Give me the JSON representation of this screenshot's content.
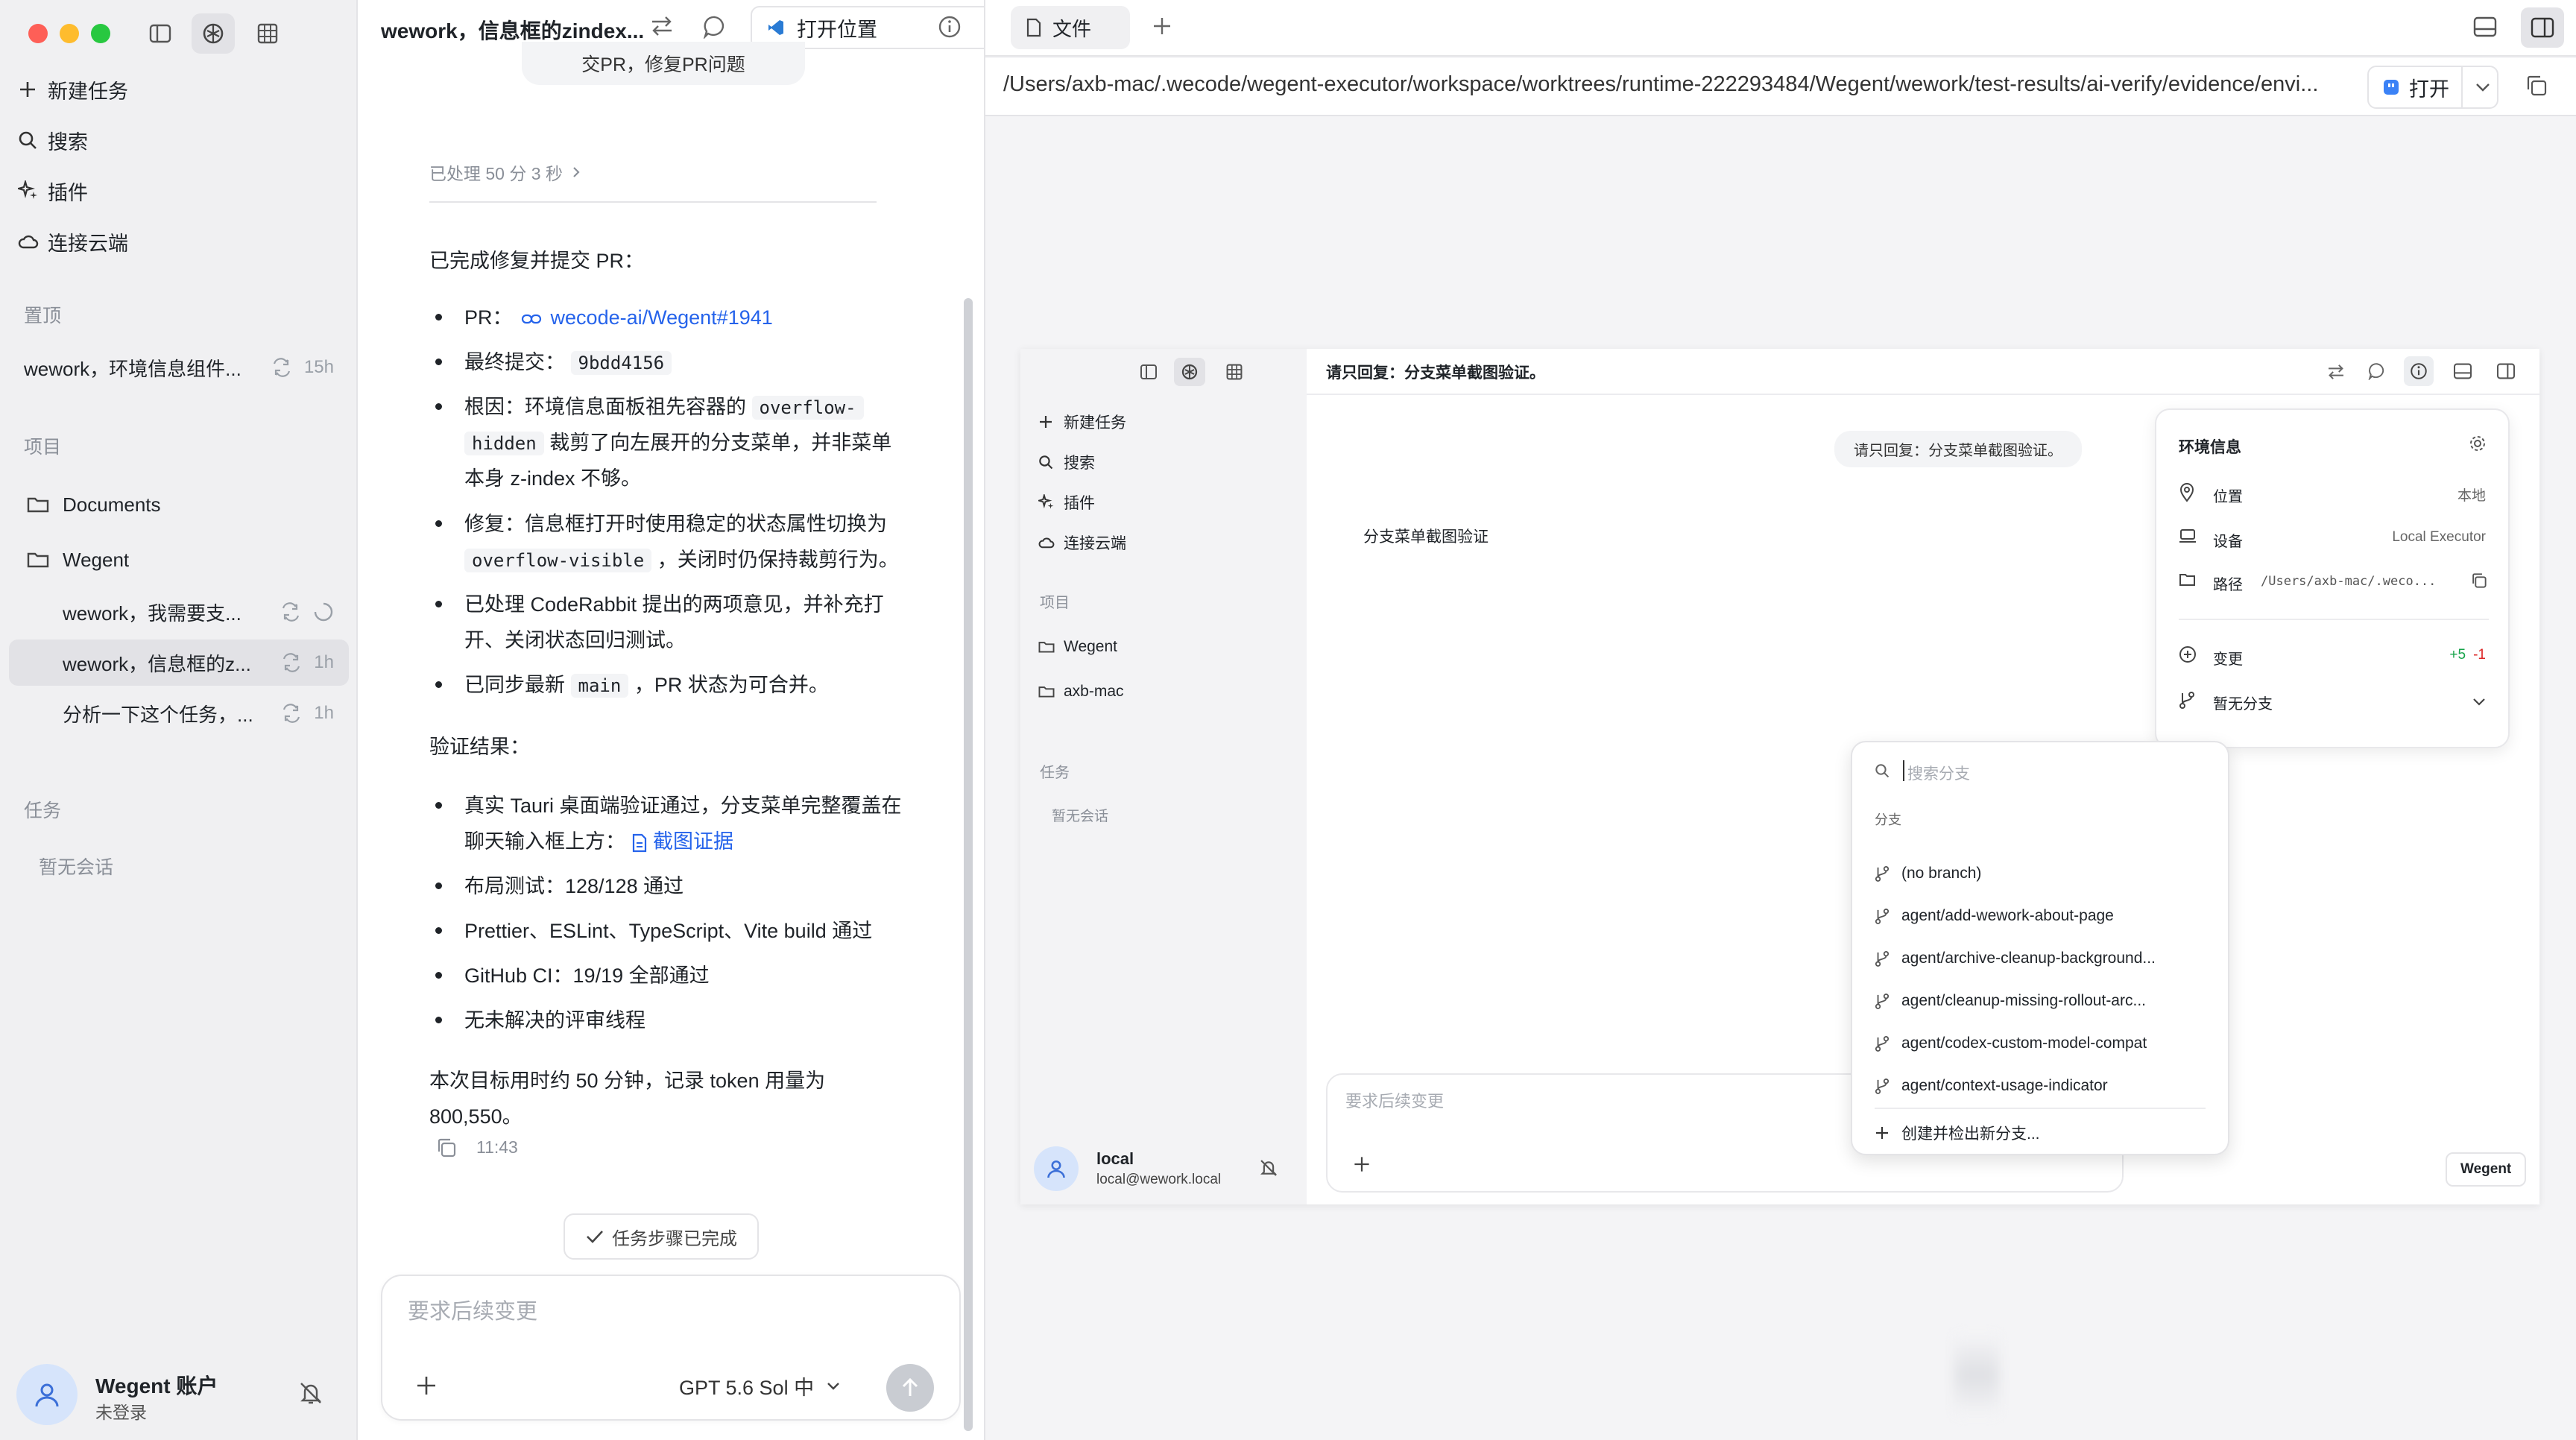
{
  "sidebar": {
    "nav": [
      {
        "label": "新建任务",
        "icon": "plus-icon"
      },
      {
        "label": "搜索",
        "icon": "search-icon"
      },
      {
        "label": "插件",
        "icon": "sparkle-icon"
      },
      {
        "label": "连接云端",
        "icon": "cloud-icon"
      }
    ],
    "pinned_title": "置顶",
    "pinned": [
      {
        "label": "wework，环境信息组件...",
        "time": "15h"
      }
    ],
    "projects_title": "项目",
    "projects": [
      {
        "label": "Documents"
      },
      {
        "label": "Wegent"
      }
    ],
    "project_tasks": [
      {
        "label": "wework，我需要支...",
        "time": ""
      },
      {
        "label": "wework，信息框的z...",
        "time": "1h"
      },
      {
        "label": "分析一下这个任务，...",
        "time": "1h"
      }
    ],
    "tasks_title": "任务",
    "tasks_empty": "暂无会话",
    "account": {
      "name": "Wegent 账户",
      "status": "未登录"
    }
  },
  "chat": {
    "title": "wework，信息框的zindex...",
    "open_location": "打开位置",
    "top_bubble": "交PR，修复PR问题",
    "processed": "已处理 50 分 3 秒",
    "intro": "已完成修复并提交 PR：",
    "pr_label": "PR：",
    "pr_link": "wecode-ai/Wegent#1941",
    "commit_label": "最终提交：",
    "commit_hash": "9bdd4156",
    "cause_1a": "根因：环境信息面板祖先容器的",
    "cause_code1": "overflow-",
    "cause_code2": "hidden",
    "cause_2b": "裁剪了向左展开的分支菜单，并非菜单",
    "cause_3": "本身 z-index 不够。",
    "fix_1": "修复：信息框打开时使用稳定的状态属性切换为",
    "fix_code": "overflow-visible",
    "fix_2b": "，关闭时仍保持裁剪行为。",
    "cr_1": "已处理 CodeRabbit 提出的两项意见，并补充打",
    "cr_2": "开、关闭状态回归测试。",
    "sync_1": "已同步最新",
    "sync_code": "main",
    "sync_2": "，PR 状态为可合并。",
    "verify_title": "验证结果：",
    "v1_1": "真实 Tauri 桌面端验证通过，分支菜单完整覆盖在",
    "v1_2": "聊天输入框上方：",
    "v1_link": "截图证据",
    "v2": "布局测试：128/128 通过",
    "v3": "Prettier、ESLint、TypeScript、Vite build 通过",
    "v4": "GitHub CI：19/19 全部通过",
    "v5": "无未解决的评审线程",
    "summary_1": "本次目标用时约 50 分钟，记录 token 用量为",
    "summary_2": "800,550。",
    "time": "11:43",
    "steps_done": "任务步骤已完成",
    "input_placeholder": "要求后续变更",
    "model": "GPT 5.6 Sol 中"
  },
  "right": {
    "tab": "文件",
    "path": "/Users/axb-mac/.wecode/wegent-executor/workspace/worktrees/runtime-222293484/Wegent/wework/test-results/ai-verify/evidence/envi...",
    "open_btn": "打开"
  },
  "inner": {
    "nav": [
      {
        "label": "新建任务"
      },
      {
        "label": "搜索"
      },
      {
        "label": "插件"
      },
      {
        "label": "连接云端"
      }
    ],
    "projects_title": "项目",
    "projects": [
      {
        "label": "Wegent"
      },
      {
        "label": "axb-mac"
      }
    ],
    "tasks_title": "任务",
    "tasks_empty": "暂无会话",
    "user": {
      "name": "local",
      "email": "local@wework.local"
    },
    "title": "请只回复：分支菜单截图验证。",
    "bubble": "请只回复：分支菜单截图验证。",
    "reply": "分支菜单截图验证",
    "env": {
      "title": "环境信息",
      "location_label": "位置",
      "location_value": "本地",
      "device_label": "设备",
      "device_value": "Local Executor",
      "path_label": "路径",
      "path_value": "/Users/axb-mac/.weco...",
      "changes_label": "变更",
      "added": "+5",
      "removed": "-1",
      "branch_label": "暂无分支"
    },
    "branch_menu": {
      "search_placeholder": "搜索分支",
      "section": "分支",
      "branches": [
        "(no branch)",
        "agent/add-wework-about-page",
        "agent/archive-cleanup-background...",
        "agent/cleanup-missing-rollout-arc...",
        "agent/codex-custom-model-compat",
        "agent/context-usage-indicator"
      ],
      "create": "创建并检出新分支..."
    },
    "input_placeholder": "要求后续变更",
    "badge": "Wegent"
  },
  "colors": {
    "link": "#2563eb",
    "added": "#16a34a",
    "removed": "#dc2626"
  }
}
